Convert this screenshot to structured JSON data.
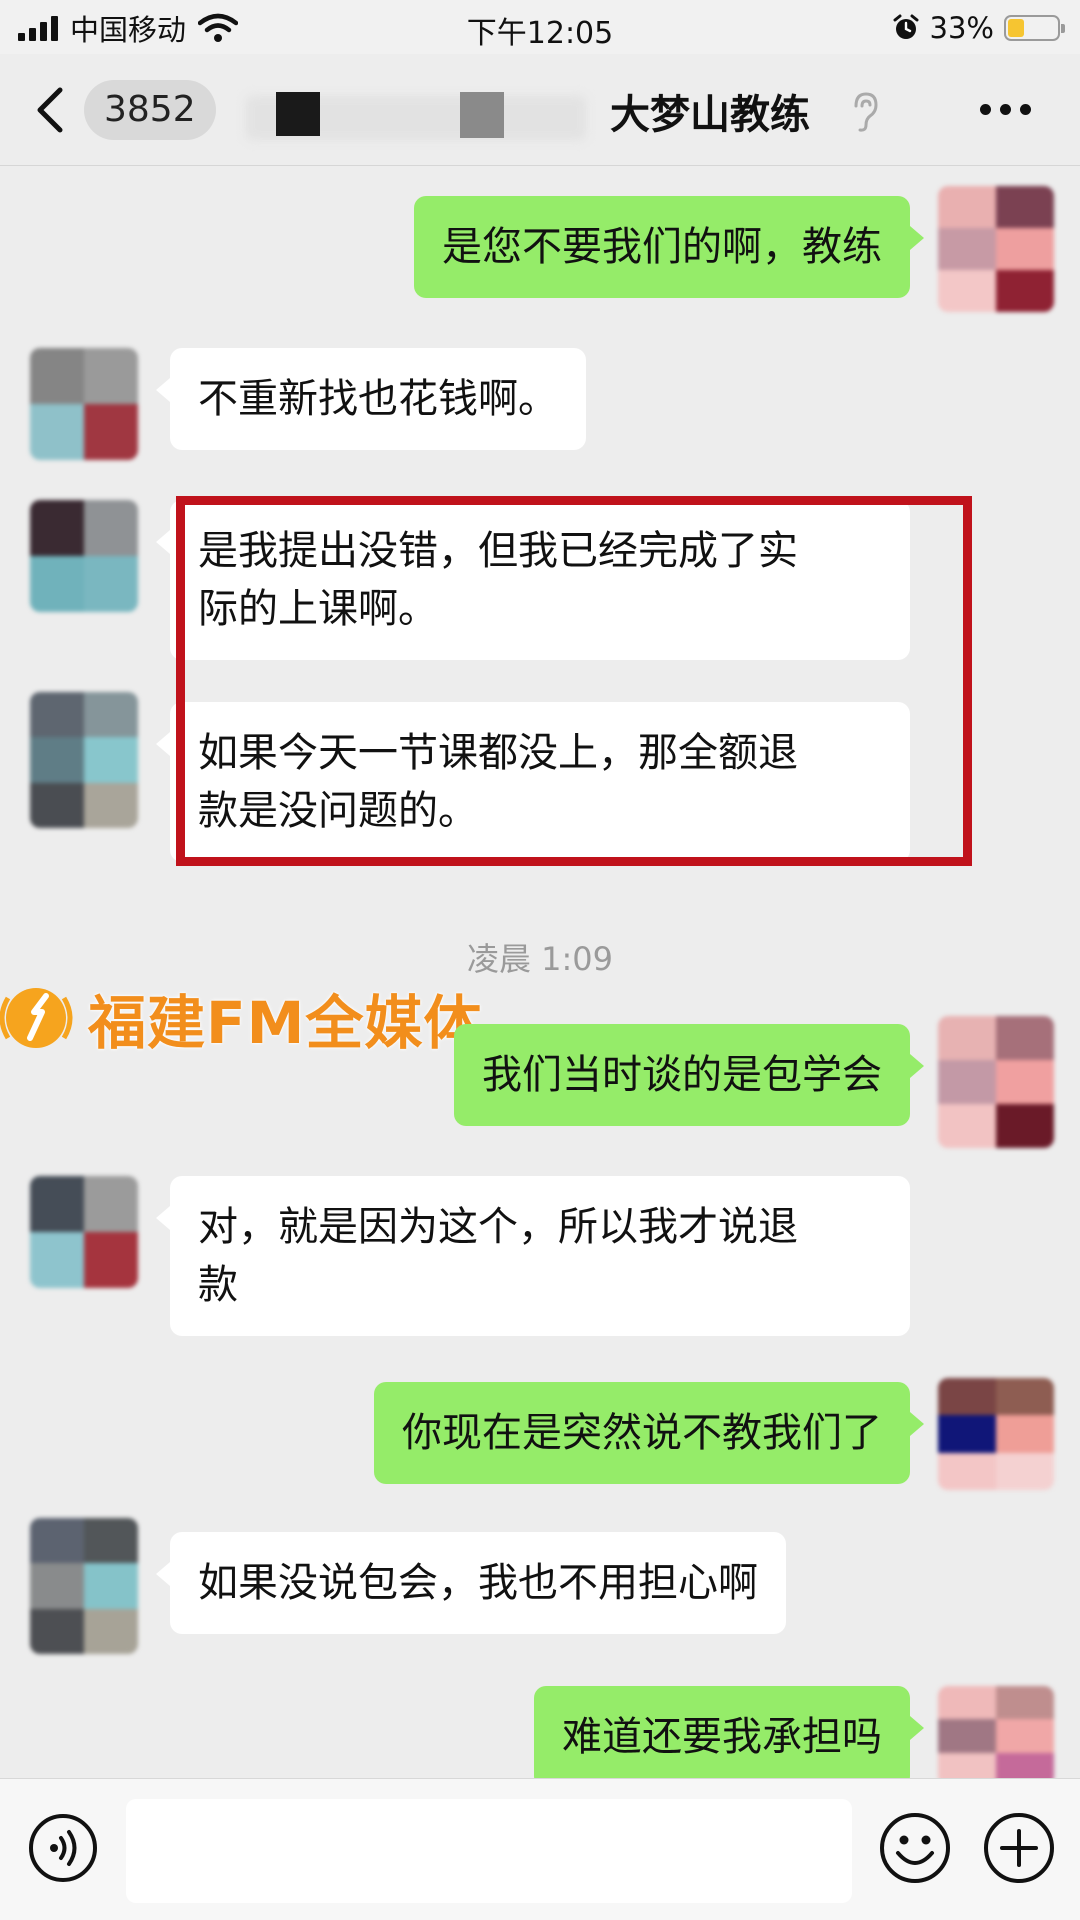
{
  "status_bar": {
    "carrier": "中国移动",
    "time": "下午12:05",
    "battery_percent": "33%",
    "battery_level": 0.33,
    "battery_color": "#f6c531"
  },
  "nav": {
    "unread_count": "3852",
    "title": "大梦山教练",
    "icons": [
      "chevron-left-icon",
      "ear-icon",
      "more-dots-icon"
    ]
  },
  "messages": [
    {
      "side": "out",
      "text": "是您不要我们的啊，教练"
    },
    {
      "side": "in",
      "text": "不重新找也花钱啊。"
    },
    {
      "side": "in",
      "text": "是我提出没错，但我已经完成了实际的上课啊。",
      "lines": [
        "是我提出没错，但我已经完成了实",
        "际的上课啊。"
      ]
    },
    {
      "side": "in",
      "text": "如果今天一节课都没上，那全额退款是没问题的。",
      "lines": [
        "如果今天一节课都没上，那全额退",
        "款是没问题的。"
      ]
    },
    {
      "side": "out",
      "text": "我们当时谈的是包学会"
    },
    {
      "side": "in",
      "text": "对，就是因为这个，所以我才说退款",
      "lines": [
        "对，就是因为这个，所以我才说退",
        "款"
      ]
    },
    {
      "side": "out",
      "text": "你现在是突然说不教我们了"
    },
    {
      "side": "in",
      "text": "如果没说包会，我也不用担心啊"
    },
    {
      "side": "out",
      "text": "难道还要我承担吗"
    }
  ],
  "timestamp": "凌晨 1:09",
  "watermark": {
    "text": "福建FM全媒体",
    "color": "#f28e1c"
  },
  "colors": {
    "outgoing_bubble": "#95ec69",
    "incoming_bubble": "#ffffff",
    "highlight_box": "#c0121b",
    "background": "#ededed"
  },
  "input_bar": {
    "placeholder": "",
    "icons": [
      "voice-icon",
      "emoji-icon",
      "plus-icon"
    ]
  }
}
